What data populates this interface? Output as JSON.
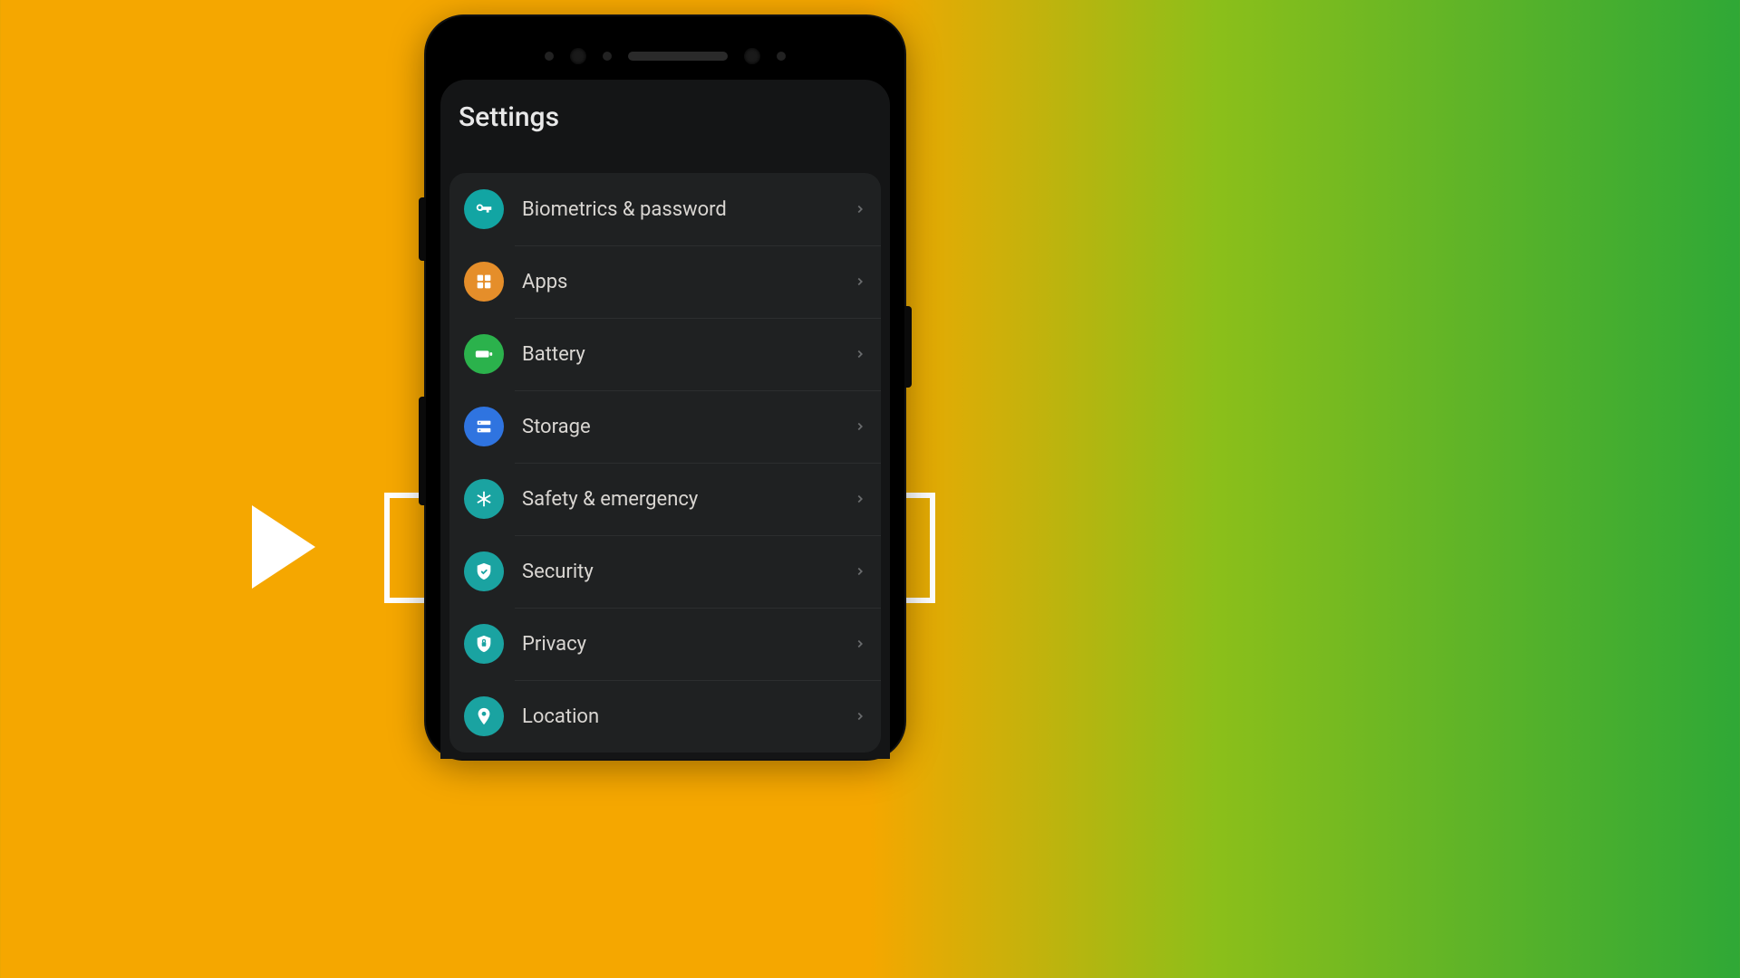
{
  "header": {
    "title": "Settings"
  },
  "items": [
    {
      "label": "Biometrics & password"
    },
    {
      "label": "Apps"
    },
    {
      "label": "Battery"
    },
    {
      "label": "Storage"
    },
    {
      "label": "Safety & emergency"
    },
    {
      "label": "Security"
    },
    {
      "label": "Privacy"
    },
    {
      "label": "Location"
    }
  ],
  "highlight": {
    "target_index": 5
  }
}
